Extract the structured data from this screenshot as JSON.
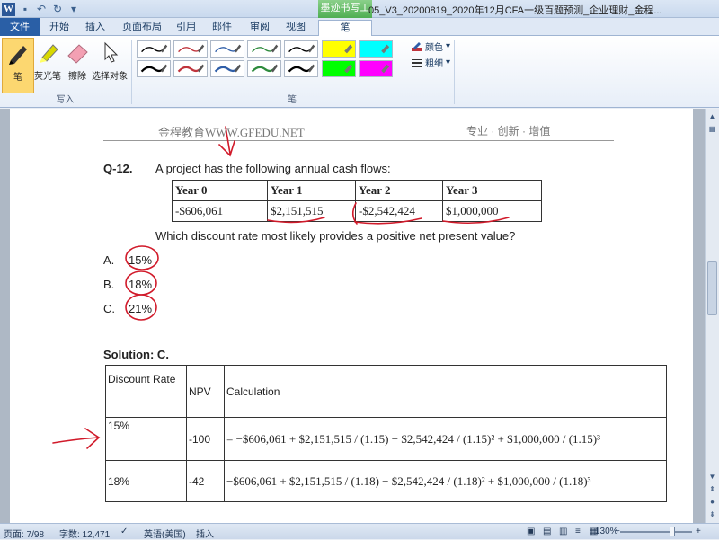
{
  "window": {
    "title": "05_V3_20200819_2020年12月CFA一级百题预测_企业理财_金程...",
    "context_tab": "墨迹书写工具"
  },
  "tabs": [
    {
      "label": "文件"
    },
    {
      "label": "开始"
    },
    {
      "label": "插入"
    },
    {
      "label": "页面布局"
    },
    {
      "label": "引用"
    },
    {
      "label": "邮件"
    },
    {
      "label": "审阅"
    },
    {
      "label": "视图"
    },
    {
      "label": "笔"
    }
  ],
  "ribbon": {
    "tools": [
      {
        "label": "笔",
        "icon": "pen-icon"
      },
      {
        "label": "荧光笔",
        "icon": "highlighter-icon"
      },
      {
        "label": "擦除",
        "icon": "eraser-icon"
      },
      {
        "label": "选择对象",
        "icon": "select-arrow-icon"
      }
    ],
    "group_write": "写入",
    "group_pens": "笔",
    "color_label": "颜色",
    "thickness_label": "粗细",
    "pen_swatches": [
      {
        "color": "#000000"
      },
      {
        "color": "#c0343c"
      },
      {
        "color": "#2f5ea8"
      },
      {
        "color": "#2e8b3d"
      },
      {
        "color": "#000000"
      },
      {
        "color": "#000000"
      },
      {
        "color": "#c0343c"
      },
      {
        "color": "#2f5ea8"
      },
      {
        "color": "#2e8b3d"
      },
      {
        "color": "#000000"
      }
    ],
    "highlighter_swatches": [
      {
        "color": "#ffff00"
      },
      {
        "color": "#00ffff"
      },
      {
        "color": "#00ff00"
      },
      {
        "color": "#ff00ff"
      }
    ]
  },
  "document": {
    "header_left": "金程教育WWW.GFEDU.NET",
    "header_right": "专业 · 创新 · 增值",
    "question_number": "Q-12.",
    "question_text": "A project has the following annual cash flows:",
    "cash_flow_table": {
      "headers": [
        "Year 0",
        "Year 1",
        "Year 2",
        "Year 3"
      ],
      "values": [
        "-$606,061",
        "$2,151,515",
        "-$2,542,424",
        "$1,000,000"
      ]
    },
    "question_prompt": "Which discount rate most likely provides a positive net present value?",
    "options": [
      {
        "letter": "A.",
        "value": "15%"
      },
      {
        "letter": "B.",
        "value": "18%"
      },
      {
        "letter": "C.",
        "value": "21%"
      }
    ],
    "solution_label": "Solution: C.",
    "solution_table": {
      "headers": [
        "Discount Rate",
        "NPV",
        "Calculation"
      ],
      "rows": [
        {
          "rate": "15%",
          "npv": "-100",
          "calc": "= −$606,061 + $2,151,515 / (1.15) − $2,542,424 / (1.15)² + $1,000,000 / (1.15)³"
        },
        {
          "rate": "18%",
          "npv": "-42",
          "calc": "−$606,061 + $2,151,515 / (1.18) − $2,542,424 / (1.18)² + $1,000,000 / (1.18)³"
        }
      ]
    }
  },
  "status_bar": {
    "page": "页面: 7/98",
    "word_count": "字数: 12,471",
    "language": "英语(美国)",
    "mode": "插入",
    "zoom": "130%"
  }
}
